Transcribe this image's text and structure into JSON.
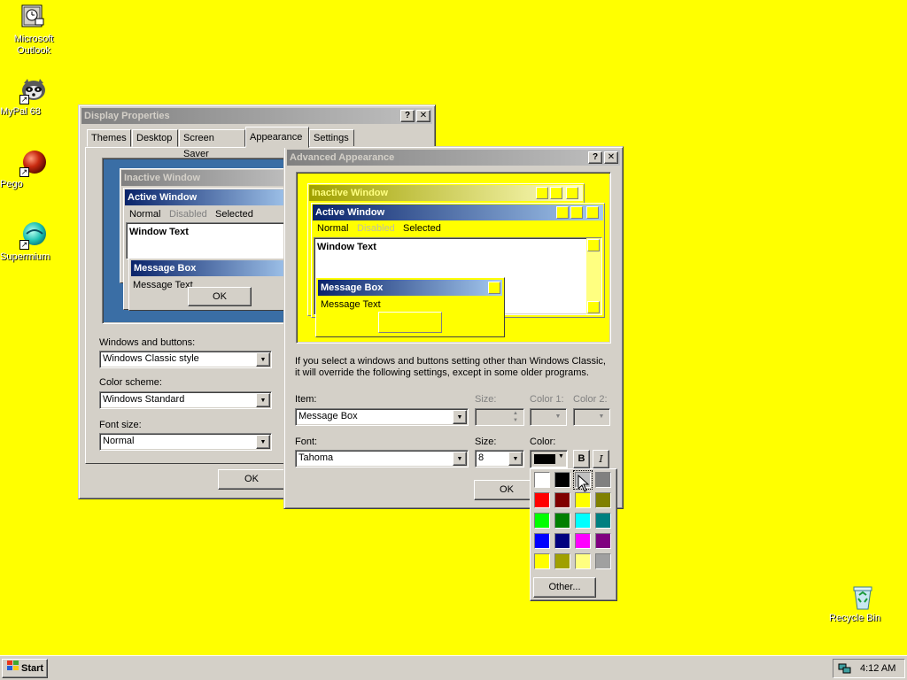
{
  "desktop": {
    "icons": [
      {
        "label": "Microsoft Outlook",
        "icon": "outlook-icon"
      },
      {
        "label": "MyPal 68",
        "icon": "mypal-raccoon-icon"
      },
      {
        "label": "Pego",
        "icon": "pego-red-ball-icon"
      },
      {
        "label": "Supermium",
        "icon": "supermium-icon"
      },
      {
        "label": "Recycle Bin",
        "icon": "recycle-bin-icon"
      }
    ]
  },
  "display_properties": {
    "title": "Display Properties",
    "help_btn": "?",
    "close_btn": "✕",
    "tabs": [
      "Themes",
      "Desktop",
      "Screen Saver",
      "Appearance",
      "Settings"
    ],
    "selected_tab": "Appearance",
    "preview": {
      "inactive_window": "Inactive Window",
      "active_window": "Active Window",
      "menu": [
        "Normal",
        "Disabled",
        "Selected"
      ],
      "window_text": "Window Text",
      "message_box": "Message Box",
      "message_text": "Message Text",
      "ok": "OK"
    },
    "windows_buttons_label": "Windows and buttons:",
    "windows_buttons_value": "Windows Classic style",
    "color_scheme_label": "Color scheme:",
    "color_scheme_value": "Windows Standard",
    "font_size_label": "Font size:",
    "font_size_value": "Normal",
    "ok": "OK"
  },
  "advanced_appearance": {
    "title": "Advanced Appearance",
    "help_btn": "?",
    "close_btn": "✕",
    "preview": {
      "inactive_window": "Inactive Window",
      "active_window": "Active Window",
      "menu": [
        "Normal",
        "Disabled",
        "Selected"
      ],
      "window_text": "Window Text",
      "message_box": "Message Box",
      "message_text": "Message Text"
    },
    "info_line1": "If you select a windows and buttons setting other than Windows Classic,",
    "info_line2": "it will override the following settings, except in some older programs.",
    "item_label": "Item:",
    "item_value": "Message Box",
    "size_label": "Size:",
    "color1_label": "Color 1:",
    "color2_label": "Color 2:",
    "font_label": "Font:",
    "font_value": "Tahoma",
    "font_size_label": "Size:",
    "font_size_value": "8",
    "font_color_label": "Color:",
    "font_color_value": "#000000",
    "bold_btn": "B",
    "italic_btn": "I",
    "ok": "OK"
  },
  "color_picker": {
    "swatches": [
      "#ffffff",
      "#000000",
      "#c0c0c0",
      "#808080",
      "#ff0000",
      "#800000",
      "#ffff00",
      "#808000",
      "#00ff00",
      "#008000",
      "#00ffff",
      "#008080",
      "#0000ff",
      "#000080",
      "#ff00ff",
      "#800080",
      "#ffff00",
      "#a0a000",
      "#ffff80",
      "#a0a0a0"
    ],
    "other_btn": "Other..."
  },
  "taskbar": {
    "start": "Start",
    "clock": "4:12 AM"
  }
}
